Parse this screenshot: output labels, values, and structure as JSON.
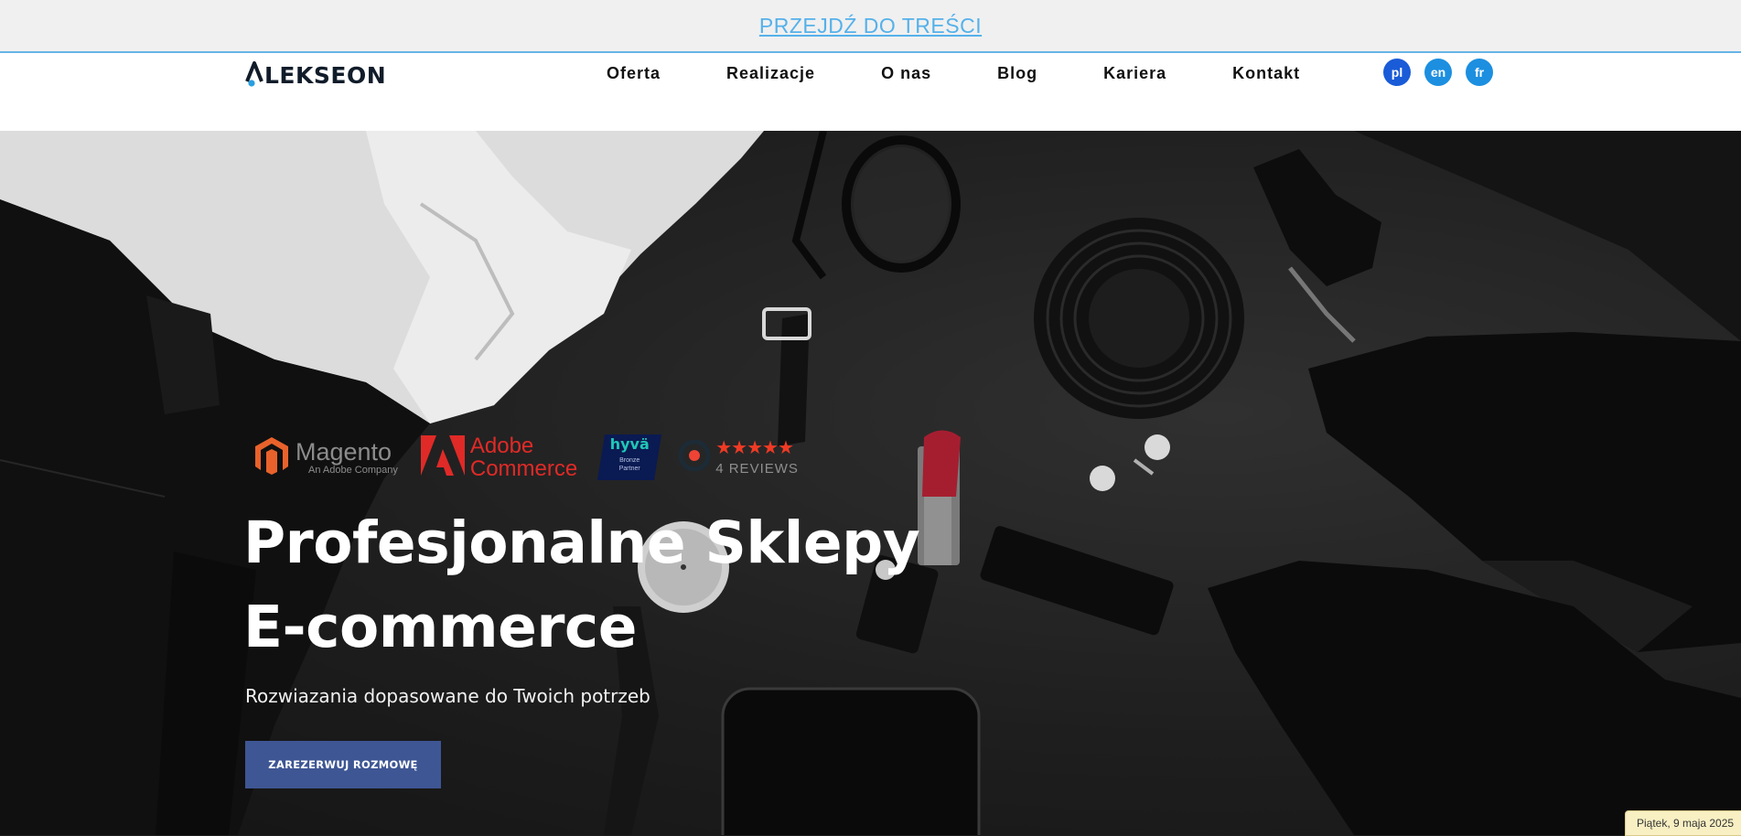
{
  "skip_link": {
    "label": "PRZEJDŹ DO TREŚCI"
  },
  "brand": {
    "name": "LEKSEON"
  },
  "nav": {
    "items": [
      {
        "label": "Oferta"
      },
      {
        "label": "Realizacje"
      },
      {
        "label": "O nas"
      },
      {
        "label": "Blog"
      },
      {
        "label": "Kariera"
      },
      {
        "label": "Kontakt"
      }
    ]
  },
  "languages": [
    {
      "code": "pl",
      "color": "#1a5bd8",
      "active": true
    },
    {
      "code": "en",
      "color": "#1c8fe0",
      "active": false
    },
    {
      "code": "fr",
      "color": "#1c8fe0",
      "active": false
    }
  ],
  "badges": {
    "magento": {
      "name": "Magento",
      "sub": "An Adobe Company",
      "color": "#e9622b"
    },
    "adobe": {
      "line1": "Adobe",
      "line2": "Commerce",
      "color": "#e02a27"
    },
    "hyva": {
      "name": "hyvä",
      "line1": "Bronze",
      "line2": "Partner"
    },
    "reviews": {
      "stars": "★★★★★",
      "rating": 5,
      "count_label": "4 REVIEWS"
    }
  },
  "hero": {
    "title_line1": "Profesjonalne Sklepy",
    "title_line2": "E-commerce",
    "subtitle": "Rozwiazania dopasowane do Twoich potrzeb",
    "cta_label": "ZAREZERWUJ ROZMOWĘ",
    "cta_color": "#3e5694"
  },
  "date_badge": {
    "text": "Piątek, 9 maja 2025"
  }
}
